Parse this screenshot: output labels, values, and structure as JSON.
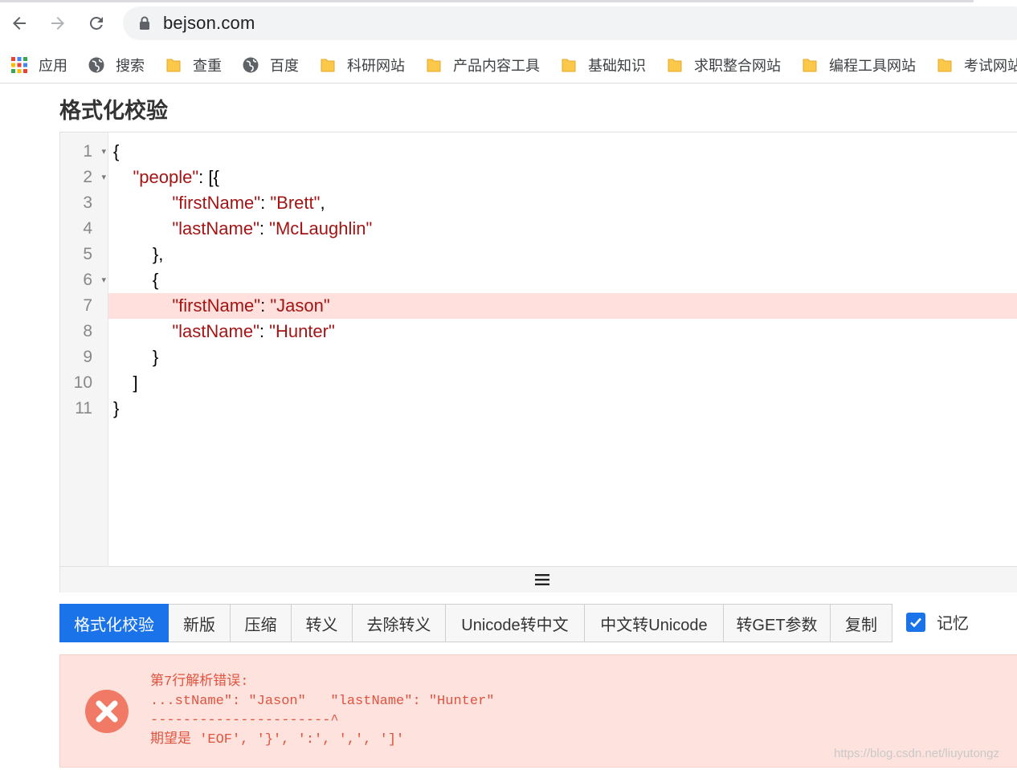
{
  "browser": {
    "url": "bejson.com",
    "bookmarks": [
      {
        "label": "应用",
        "icon": "apps-grid-icon"
      },
      {
        "label": "搜索",
        "icon": "globe-icon"
      },
      {
        "label": "查重",
        "icon": "folder-icon"
      },
      {
        "label": "百度",
        "icon": "globe-icon"
      },
      {
        "label": "科研网站",
        "icon": "folder-icon"
      },
      {
        "label": "产品内容工具",
        "icon": "folder-icon"
      },
      {
        "label": "基础知识",
        "icon": "folder-icon"
      },
      {
        "label": "求职整合网站",
        "icon": "folder-icon"
      },
      {
        "label": "编程工具网站",
        "icon": "folder-icon"
      },
      {
        "label": "考试网站",
        "icon": "folder-icon"
      }
    ]
  },
  "page": {
    "title": "格式化校验"
  },
  "editor": {
    "error_line": 7,
    "lines": [
      {
        "num": "1",
        "fold": "▾",
        "text": "{"
      },
      {
        "num": "2",
        "fold": "▾",
        "text": "    \"people\": [{"
      },
      {
        "num": "3",
        "fold": "",
        "text": "            \"firstName\": \"Brett\","
      },
      {
        "num": "4",
        "fold": "",
        "text": "            \"lastName\": \"McLaughlin\""
      },
      {
        "num": "5",
        "fold": "",
        "text": "        },"
      },
      {
        "num": "6",
        "fold": "▾",
        "text": "        {"
      },
      {
        "num": "7",
        "fold": "",
        "text": "            \"firstName\": \"Jason\""
      },
      {
        "num": "8",
        "fold": "",
        "text": "            \"lastName\": \"Hunter\""
      },
      {
        "num": "9",
        "fold": "",
        "text": "        }"
      },
      {
        "num": "10",
        "fold": "",
        "text": "    ]"
      },
      {
        "num": "11",
        "fold": "",
        "text": "}"
      }
    ]
  },
  "toolbar": {
    "buttons": [
      {
        "label": "格式化校验",
        "active": true
      },
      {
        "label": "新版",
        "active": false
      },
      {
        "label": "压缩",
        "active": false
      },
      {
        "label": "转义",
        "active": false
      },
      {
        "label": "去除转义",
        "active": false
      },
      {
        "label": "Unicode转中文",
        "active": false
      },
      {
        "label": "中文转Unicode",
        "active": false
      },
      {
        "label": "转GET参数",
        "active": false
      },
      {
        "label": "复制",
        "active": false
      }
    ],
    "memory_label": "记忆",
    "memory_checked": true
  },
  "error": {
    "line1": "第7行解析错误:",
    "line2": "...stName\": \"Jason\"   \"lastName\": \"Hunter\"",
    "line3": "----------------------^",
    "line4": "期望是 'EOF', '}', ':', ',', ']'"
  },
  "watermark": "https://blog.csdn.net/liuyutongz",
  "colors": {
    "accent": "#1a73e8",
    "error_bg": "#fde2de",
    "error_text": "#e0543f",
    "error_line_bg": "#ffe0dc",
    "string": "#a31515"
  }
}
